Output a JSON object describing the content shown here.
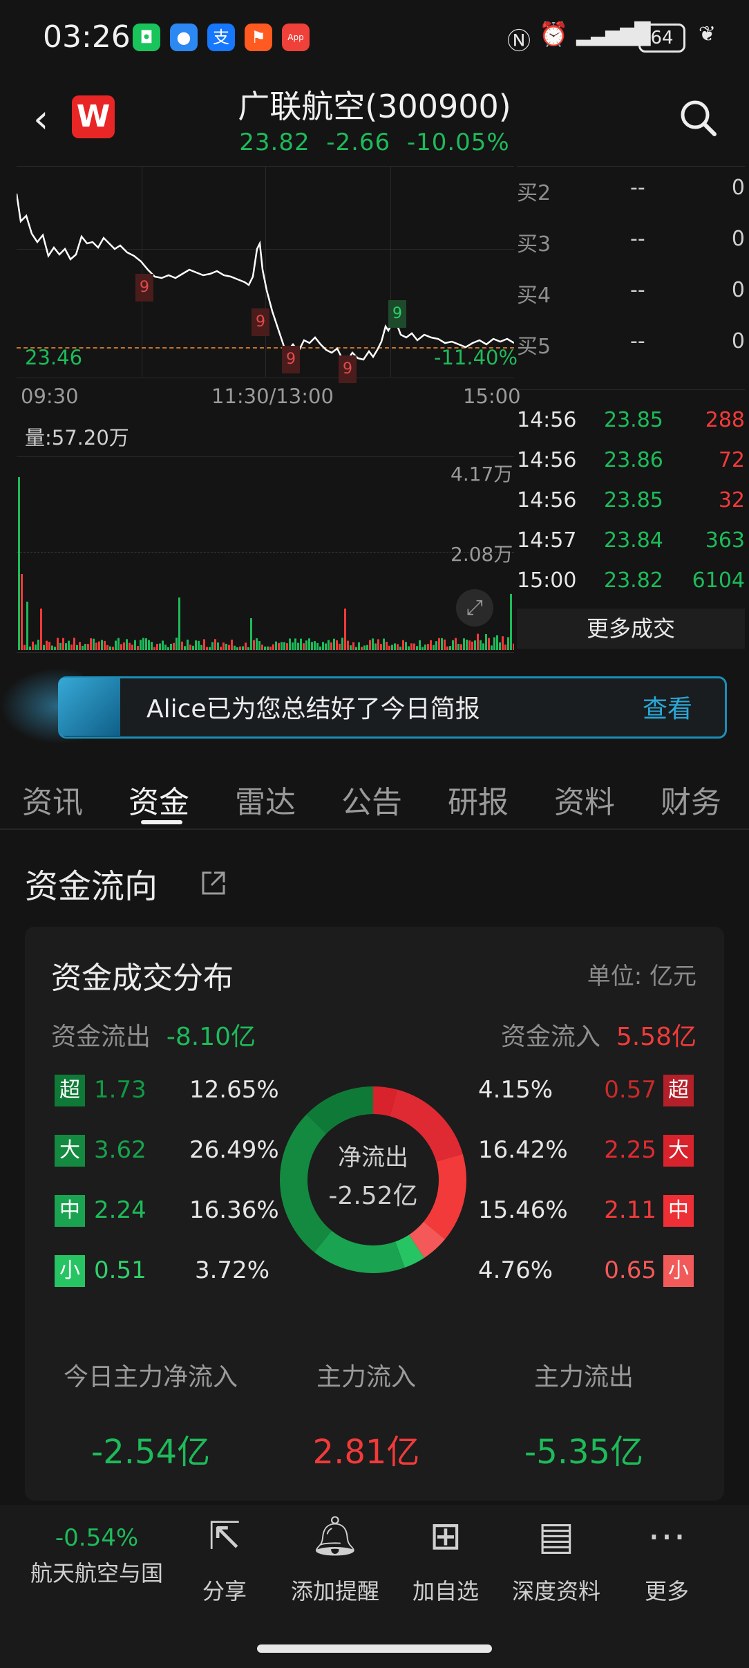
{
  "status_bar": {
    "time": "03:26",
    "battery": "64",
    "apps": [
      {
        "icon": "wechat-icon",
        "glyph": "◘",
        "color": "#19c45b"
      },
      {
        "icon": "message-icon",
        "glyph": "●",
        "color": "#2c88f2"
      },
      {
        "icon": "alipay-icon",
        "glyph": "支",
        "color": "#1677ff"
      },
      {
        "icon": "fire-app-icon",
        "glyph": "⚑",
        "color": "#ff5a1f"
      },
      {
        "icon": "appgallery-icon",
        "glyph": "App",
        "color": "#f0403a"
      }
    ]
  },
  "header": {
    "title": "广联航空(300900)",
    "price": "23.82",
    "change": "-2.66",
    "change_pct": "-10.05%"
  },
  "chart": {
    "ref_price": "23.46",
    "pct_label": "-11.40%",
    "x_labels": [
      "09:30",
      "11:30/13:00",
      "15:00"
    ],
    "markers": [
      "9",
      "9",
      "9",
      "9",
      "9"
    ],
    "volume_label": "量:57.20万",
    "vol_ticks": [
      "4.17万",
      "2.08万"
    ]
  },
  "order_book": [
    {
      "label": "买2",
      "price": "--",
      "volume": "0"
    },
    {
      "label": "买3",
      "price": "--",
      "volume": "0"
    },
    {
      "label": "买4",
      "price": "--",
      "volume": "0"
    },
    {
      "label": "买5",
      "price": "--",
      "volume": "0"
    }
  ],
  "deals": [
    {
      "time": "14:56",
      "price": "23.85",
      "volume": "288"
    },
    {
      "time": "14:56",
      "price": "23.86",
      "volume": "72"
    },
    {
      "time": "14:56",
      "price": "23.85",
      "volume": "32"
    },
    {
      "time": "14:57",
      "price": "23.84",
      "volume": "363"
    },
    {
      "time": "15:00",
      "price": "23.82",
      "volume": "6104"
    }
  ],
  "more_deals_label": "更多成交",
  "banner": {
    "text": "Alice已为您总结好了今日简报",
    "button": "查看"
  },
  "tabs": [
    "资讯",
    "资金",
    "雷达",
    "公告",
    "研报",
    "资料",
    "财务"
  ],
  "fund_flow": {
    "section_title": "资金流向",
    "card_title": "资金成交分布",
    "unit": "单位: 亿元",
    "outflow_label": "资金流出",
    "outflow_value": "-8.10亿",
    "inflow_label": "资金流入",
    "inflow_value": "5.58亿",
    "outflow_rows": [
      {
        "badge": "超",
        "amount": "1.73",
        "pct": "12.65%"
      },
      {
        "badge": "大",
        "amount": "3.62",
        "pct": "26.49%"
      },
      {
        "badge": "中",
        "amount": "2.24",
        "pct": "16.36%"
      },
      {
        "badge": "小",
        "amount": "0.51",
        "pct": "3.72%"
      }
    ],
    "inflow_rows": [
      {
        "badge": "超",
        "amount": "0.57",
        "pct": "4.15%"
      },
      {
        "badge": "大",
        "amount": "2.25",
        "pct": "16.42%"
      },
      {
        "badge": "中",
        "amount": "2.11",
        "pct": "15.46%"
      },
      {
        "badge": "小",
        "amount": "0.65",
        "pct": "4.76%"
      }
    ],
    "donut_label": "净流出",
    "donut_value": "-2.52亿",
    "summary": [
      {
        "label": "今日主力净流入",
        "value": "-2.54亿"
      },
      {
        "label": "主力流入",
        "value": "2.81亿"
      },
      {
        "label": "主力流出",
        "value": "-5.35亿"
      }
    ]
  },
  "bottom_bar": {
    "index_pct": "-0.54%",
    "index_name": "航天航空与国",
    "items": [
      {
        "icon": "share-icon",
        "glyph": "⇱",
        "label": "分享"
      },
      {
        "icon": "bell-icon",
        "glyph": "♫",
        "label": "添加提醒"
      },
      {
        "icon": "add-watchlist-icon",
        "glyph": "⊞",
        "label": "加自选"
      },
      {
        "icon": "report-icon",
        "glyph": "▤",
        "label": "深度资料"
      },
      {
        "icon": "more-icon",
        "glyph": "⋯",
        "label": "更多"
      }
    ]
  },
  "colors": {
    "up": "#f23a3a",
    "down": "#1dbb5a",
    "accent": "#29a9d8"
  }
}
